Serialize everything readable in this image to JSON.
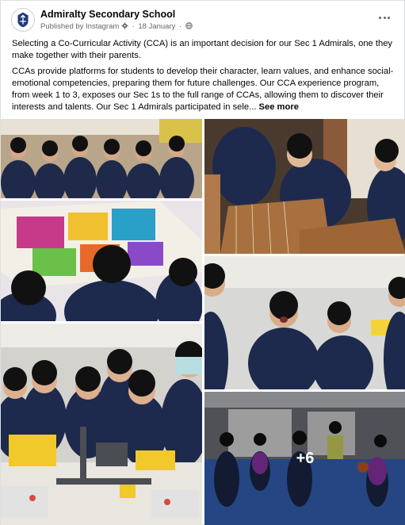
{
  "post": {
    "author": "Admiralty Secondary School",
    "published_by": "Published by Instagram",
    "date": "18 January",
    "paragraph1": "Selecting a Co-Curricular Activity (CCA) is an important decision for our Sec 1 Admirals, one they make together with their parents.",
    "paragraph2": "CCAs provide platforms for students to develop their character, learn values, and enhance social-emotional competencies, preparing them for future challenges. Our CCA experience program, from week 1 to 3, exposes our Sec 1s to the full range of CCAs, allowing them to discover their interests and talents. Our Sec 1 Admirals participated in sele...",
    "see_more": "See more",
    "more_photos": "+6"
  },
  "icons": [
    "school-crest-icon",
    "gear-icon",
    "globe-icon",
    "more-options-icon"
  ],
  "colors": {
    "secondary_text": "#65676b",
    "uniform_navy": "#1d2a4d",
    "card_border": "#dddfe2"
  }
}
